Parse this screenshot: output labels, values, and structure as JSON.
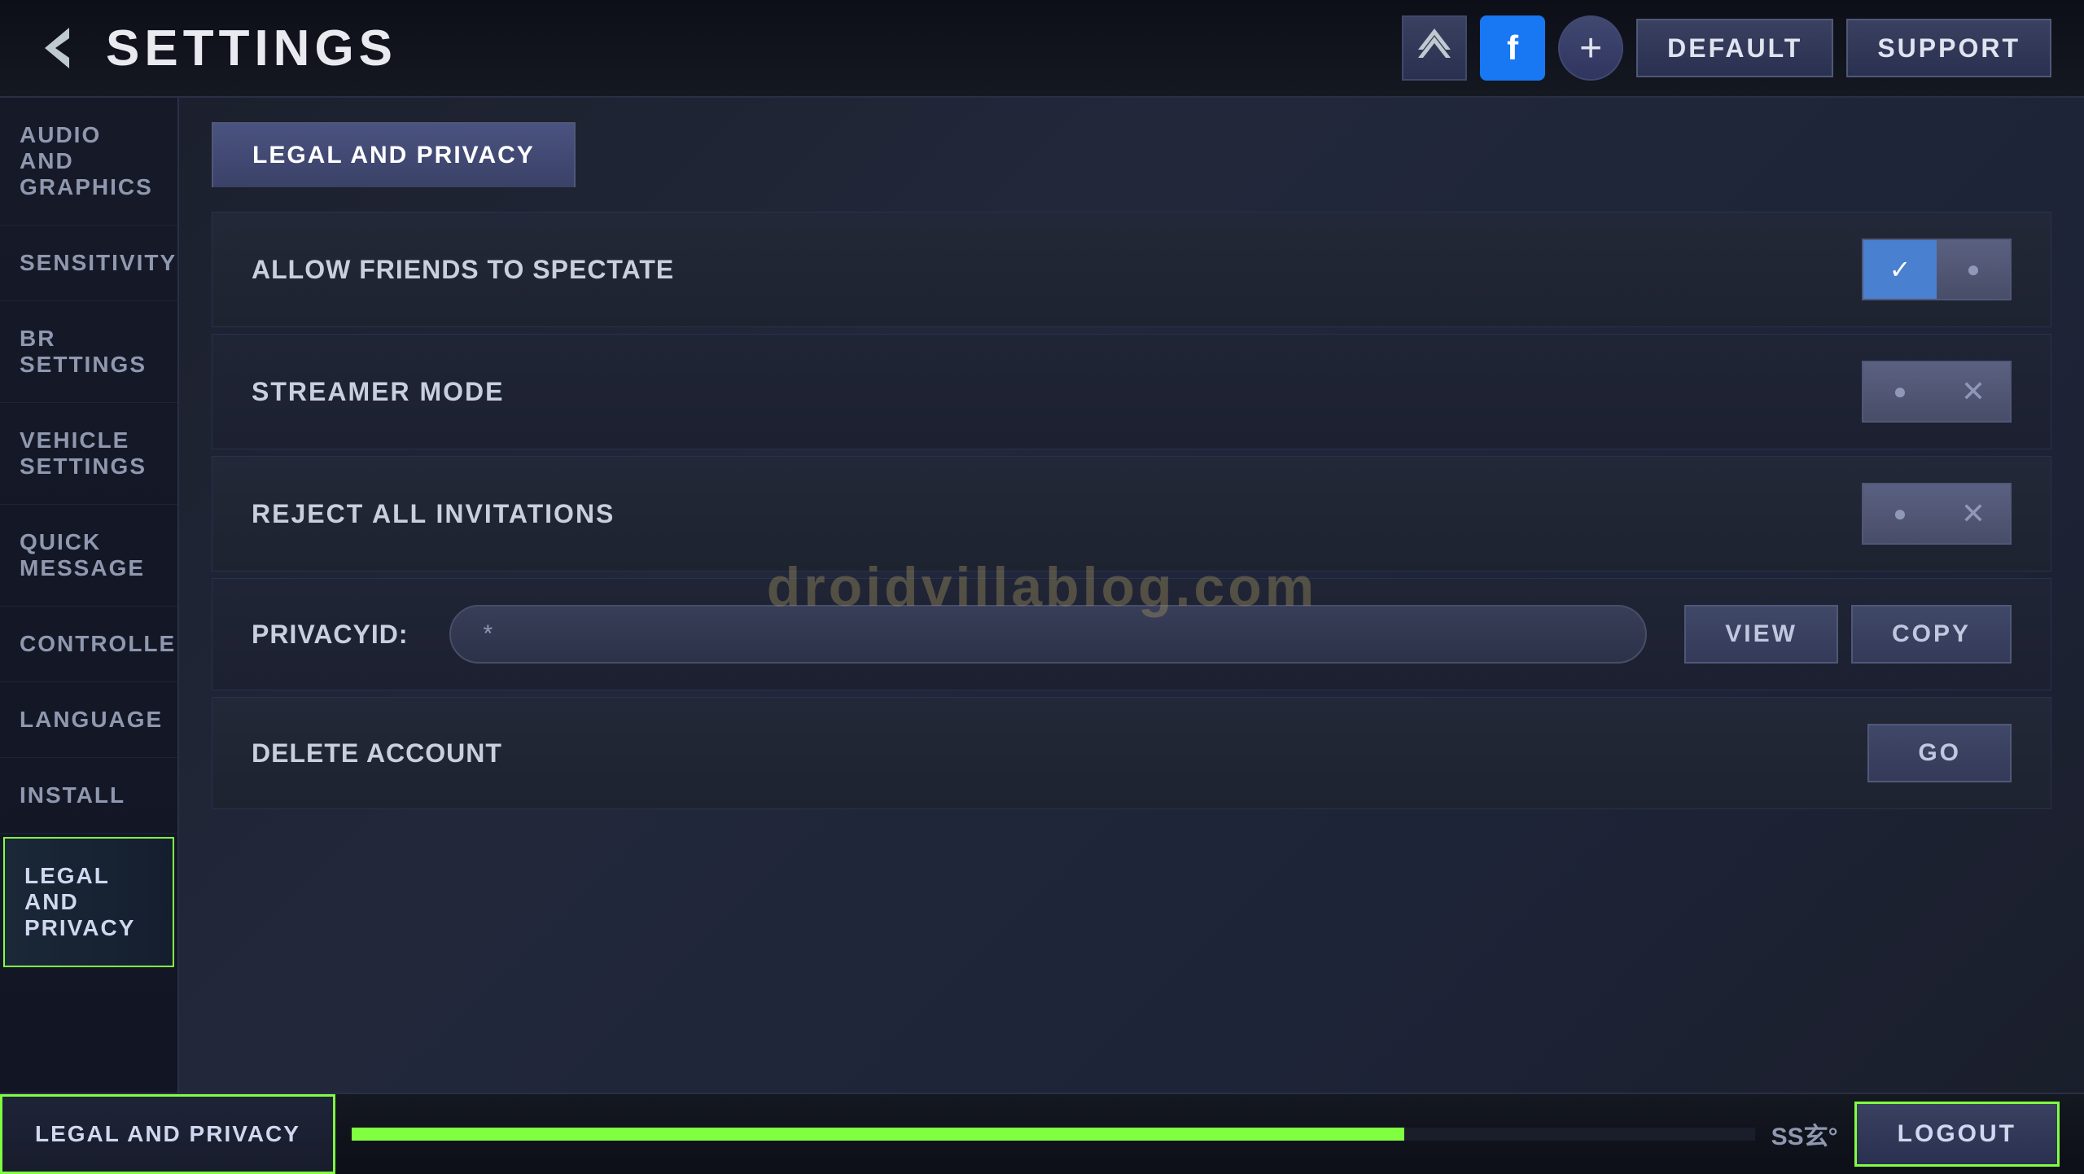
{
  "header": {
    "title": "SETTINGS",
    "back_label": "Back",
    "default_label": "DEFAULT",
    "support_label": "SUPPORT"
  },
  "sidebar": {
    "items": [
      {
        "id": "audio-graphics",
        "label": "AUDIO AND GRAPHICS"
      },
      {
        "id": "sensitivity",
        "label": "SENSITIVITY"
      },
      {
        "id": "br-settings",
        "label": "BR SETTINGS"
      },
      {
        "id": "vehicle-settings",
        "label": "VEHICLE SETTINGS"
      },
      {
        "id": "quick-message",
        "label": "QUICK MESSAGE"
      },
      {
        "id": "controller",
        "label": "CONTROLLER"
      },
      {
        "id": "language",
        "label": "LANGUAGE"
      },
      {
        "id": "install",
        "label": "INSTALL"
      },
      {
        "id": "legal-privacy",
        "label": "LEGAL AND PRIVACY",
        "active": true
      }
    ]
  },
  "content": {
    "tab_label": "LEGAL AND PRIVACY",
    "rows": [
      {
        "id": "allow-friends",
        "label": "Allow Friends to Spectate",
        "has_toggle": true,
        "toggle_state": "on"
      },
      {
        "id": "streamer-mode",
        "label": "STREAMER MODE",
        "has_toggle": true,
        "toggle_state": "off",
        "bold": true
      },
      {
        "id": "reject-invitations",
        "label": "REJECT ALL INVITATIONS",
        "has_toggle": true,
        "toggle_state": "off",
        "bold": true
      },
      {
        "id": "privacy-id",
        "label": "PrivacyID:",
        "is_privacy_id": true,
        "view_label": "VIEW",
        "copy_label": "COPY"
      },
      {
        "id": "delete-account",
        "label": "Delete Account",
        "has_go": true,
        "go_label": "GO"
      }
    ]
  },
  "bottom_bar": {
    "active_item_label": "LEGAL AND PRIVACY",
    "lang_label": "SS玄°",
    "logout_label": "LOGOUT"
  },
  "watermark": {
    "text": "droidvillablog.com"
  }
}
